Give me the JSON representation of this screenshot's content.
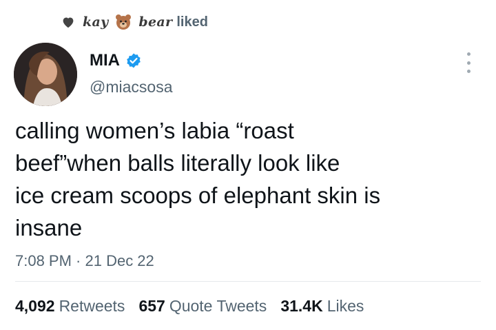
{
  "liked_by": {
    "name_part1": "kay",
    "name_part2": "bear",
    "label": "liked",
    "heart_icon": "heart-icon",
    "bear_icon": "bear-emoji"
  },
  "author": {
    "display_name": "MIA",
    "handle": "@miacsosa",
    "verified": true,
    "verified_color": "#1d9bf0"
  },
  "tweet": {
    "lines": [
      "calling women’s labia “roast",
      "beef”when balls literally look like",
      "ice cream scoops of elephant skin is",
      "insane"
    ],
    "timestamp": "7:08 PM · 21 Dec 22"
  },
  "stats": {
    "retweets_count": "4,092",
    "retweets_label": "Retweets",
    "quotes_count": "657",
    "quotes_label": "Quote Tweets",
    "likes_count": "31.4K",
    "likes_label": "Likes"
  }
}
